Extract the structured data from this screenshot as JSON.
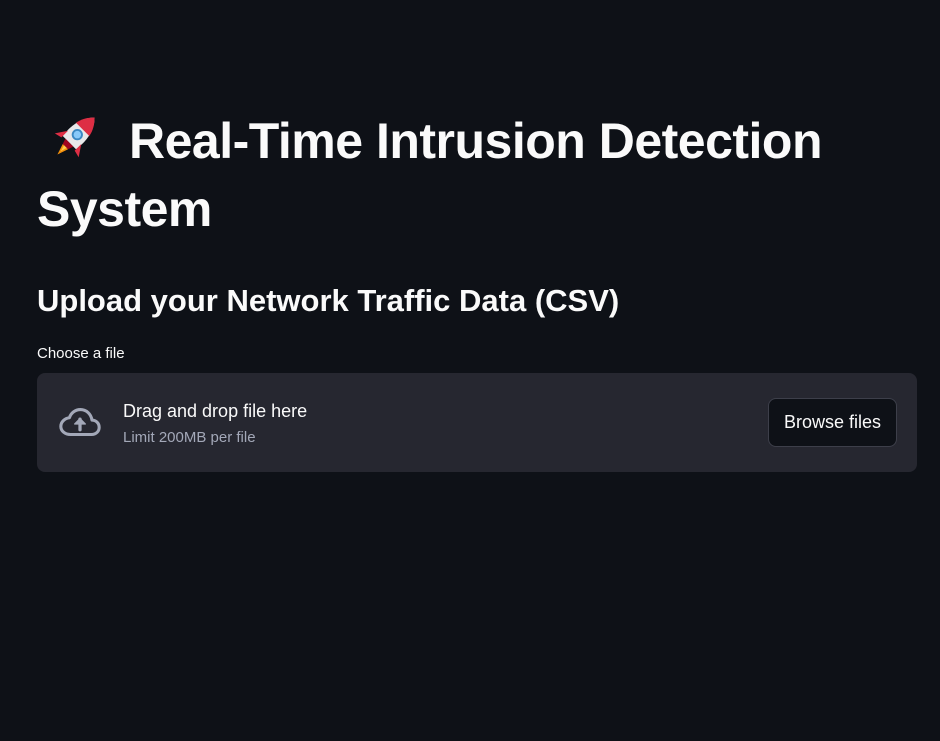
{
  "page": {
    "title_line": "Real-Time Intrusion Detection System",
    "title_icon": "rocket-icon",
    "subtitle": "Upload your Network Traffic Data (CSV)"
  },
  "uploader": {
    "label": "Choose a file",
    "drop_text": "Drag and drop file here",
    "limit_text": "Limit 200MB per file",
    "button_label": "Browse files",
    "icon": "cloud-upload-icon"
  },
  "colors": {
    "background": "#0e1117",
    "dropzone": "#262730",
    "text": "#fafafa",
    "muted_text": "#a3a8b8"
  }
}
